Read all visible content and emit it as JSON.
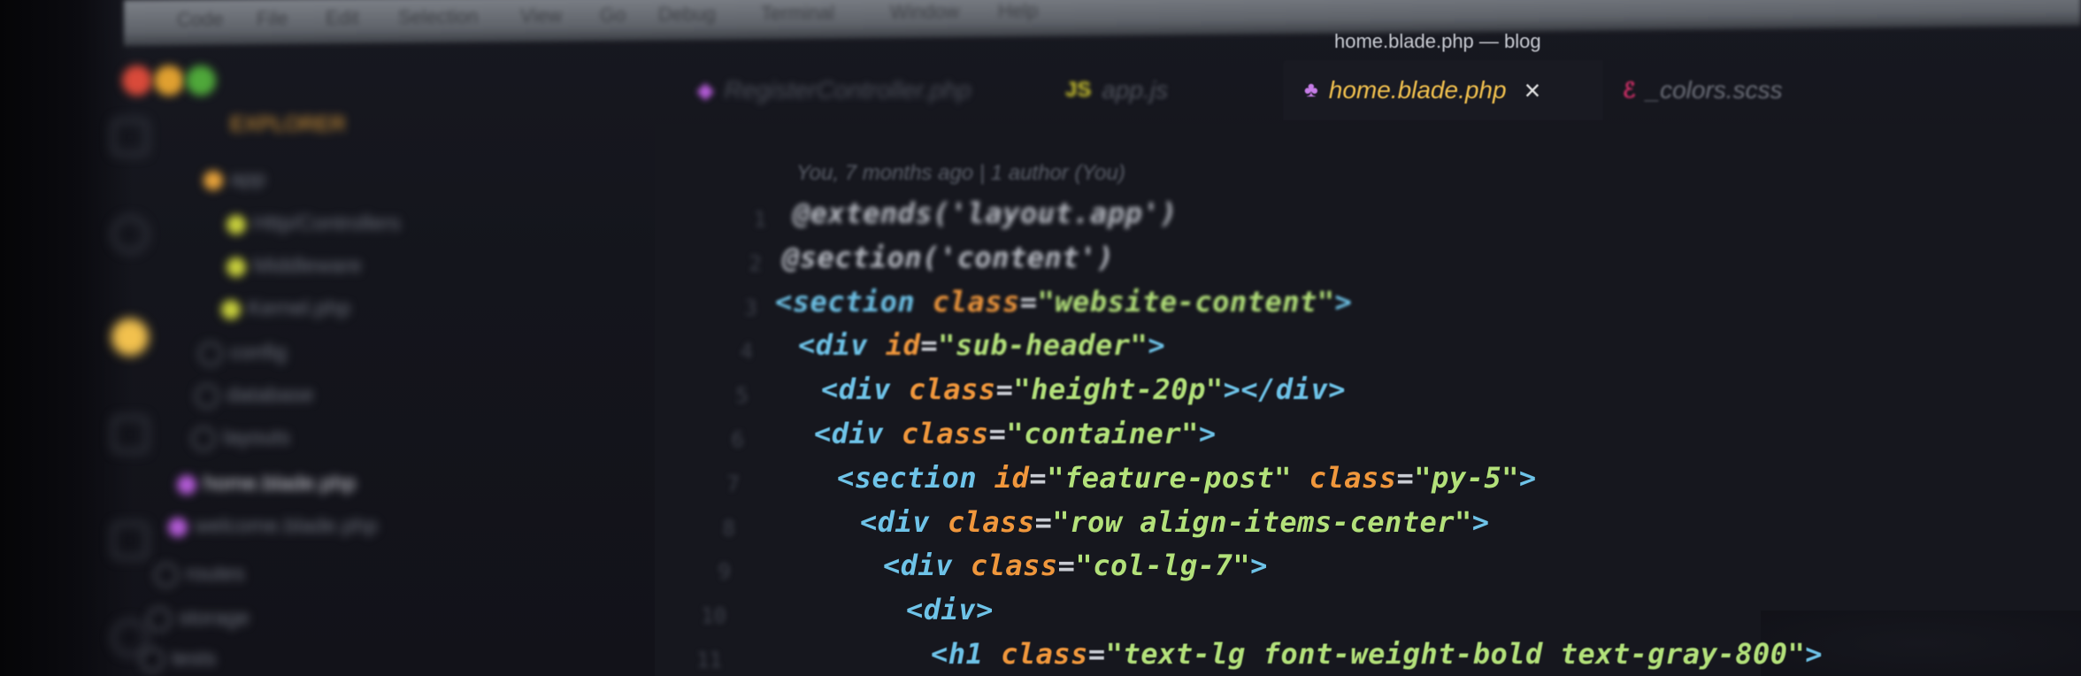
{
  "window": {
    "title": "home.blade.php — blog"
  },
  "menubar": {
    "items": [
      "Code",
      "File",
      "Edit",
      "Selection",
      "View",
      "Go",
      "Debug",
      "Terminal",
      "Window",
      "Help"
    ]
  },
  "sidebar": {
    "header": "EXPLORER",
    "items": [
      {
        "label": "app",
        "color": "#e8a33a"
      },
      {
        "label": "Http/Controllers",
        "color": "#c9d13c"
      },
      {
        "label": "Middleware",
        "color": "#c9d13c"
      },
      {
        "label": "Kernel.php",
        "color": "#c9d13c"
      },
      {
        "label": "config",
        "color": "#6b6f7a"
      },
      {
        "label": "database",
        "color": "#6b6f7a"
      },
      {
        "label": "layouts",
        "color": "#6b6f7a"
      },
      {
        "label": "home.blade.php",
        "color": "#b35bd6"
      },
      {
        "label": "welcome.blade.php",
        "color": "#b35bd6"
      },
      {
        "label": "routes",
        "color": "#6b6f7a"
      },
      {
        "label": "storage",
        "color": "#6b6f7a"
      },
      {
        "label": "tests",
        "color": "#6b6f7a"
      }
    ]
  },
  "tabs": [
    {
      "label": "RegisterController.php",
      "icon": "php-icon",
      "active": false
    },
    {
      "label": "app.js",
      "icon": "js-icon",
      "active": false
    },
    {
      "label": "home.blade.php",
      "icon": "blade-icon",
      "active": true,
      "close": "×"
    },
    {
      "label": "_colors.scss",
      "icon": "sass-icon",
      "active": false
    }
  ],
  "editor": {
    "blame": "You, 7 months ago | 1 author (You)",
    "line_numbers": [
      "1",
      "2",
      "3",
      "4",
      "5",
      "6",
      "7",
      "8",
      "9",
      "10",
      "11"
    ],
    "lines": [
      [
        {
          "t": "@extends('layout.app')",
          "k": "at"
        }
      ],
      [
        {
          "t": "@section('content')",
          "k": "at"
        }
      ],
      [
        {
          "t": "<",
          "k": "punc"
        },
        {
          "t": "section",
          "k": "tag"
        },
        {
          "t": " class",
          "k": "attr"
        },
        {
          "t": "=",
          "k": "eq"
        },
        {
          "t": "\"website-content\"",
          "k": "str"
        },
        {
          "t": ">",
          "k": "punc"
        }
      ],
      [
        {
          "t": "<",
          "k": "punc"
        },
        {
          "t": "div",
          "k": "tag"
        },
        {
          "t": " id",
          "k": "attr"
        },
        {
          "t": "=",
          "k": "eq"
        },
        {
          "t": "\"sub-header\"",
          "k": "str"
        },
        {
          "t": ">",
          "k": "punc"
        }
      ],
      [
        {
          "t": "<",
          "k": "punc"
        },
        {
          "t": "div",
          "k": "tag"
        },
        {
          "t": " class",
          "k": "attr"
        },
        {
          "t": "=",
          "k": "eq"
        },
        {
          "t": "\"height-20p\"",
          "k": "str"
        },
        {
          "t": "></",
          "k": "punc"
        },
        {
          "t": "div",
          "k": "tag"
        },
        {
          "t": ">",
          "k": "punc"
        }
      ],
      [
        {
          "t": "<",
          "k": "punc"
        },
        {
          "t": "div",
          "k": "tag"
        },
        {
          "t": " class",
          "k": "attr"
        },
        {
          "t": "=",
          "k": "eq"
        },
        {
          "t": "\"container\"",
          "k": "str"
        },
        {
          "t": ">",
          "k": "punc"
        }
      ],
      [
        {
          "t": "<",
          "k": "punc"
        },
        {
          "t": "section",
          "k": "tag"
        },
        {
          "t": " id",
          "k": "attr"
        },
        {
          "t": "=",
          "k": "eq"
        },
        {
          "t": "\"feature-post\"",
          "k": "str"
        },
        {
          "t": " class",
          "k": "attr"
        },
        {
          "t": "=",
          "k": "eq"
        },
        {
          "t": "\"py-5\"",
          "k": "str"
        },
        {
          "t": ">",
          "k": "punc"
        }
      ],
      [
        {
          "t": "<",
          "k": "punc"
        },
        {
          "t": "div",
          "k": "tag"
        },
        {
          "t": " class",
          "k": "attr"
        },
        {
          "t": "=",
          "k": "eq"
        },
        {
          "t": "\"row align-items-center\"",
          "k": "str"
        },
        {
          "t": ">",
          "k": "punc"
        }
      ],
      [
        {
          "t": "<",
          "k": "punc"
        },
        {
          "t": "div",
          "k": "tag"
        },
        {
          "t": " class",
          "k": "attr"
        },
        {
          "t": "=",
          "k": "eq"
        },
        {
          "t": "\"col-lg-7\"",
          "k": "str"
        },
        {
          "t": ">",
          "k": "punc"
        }
      ],
      [
        {
          "t": "<",
          "k": "punc"
        },
        {
          "t": "div",
          "k": "tag"
        },
        {
          "t": ">",
          "k": "punc"
        }
      ],
      [
        {
          "t": "<",
          "k": "punc"
        },
        {
          "t": "h1",
          "k": "tag"
        },
        {
          "t": " class",
          "k": "attr"
        },
        {
          "t": "=",
          "k": "eq"
        },
        {
          "t": "\"text-lg font-weight-bold text-gray-800\"",
          "k": "str"
        },
        {
          "t": ">",
          "k": "punc"
        }
      ]
    ]
  },
  "colors": {
    "active_tab_text": "#f2c14e",
    "close_icon": "#e6e6e6",
    "traffic_red": "#d94a3a",
    "traffic_yellow": "#e0a030",
    "traffic_green": "#4fa83a"
  }
}
